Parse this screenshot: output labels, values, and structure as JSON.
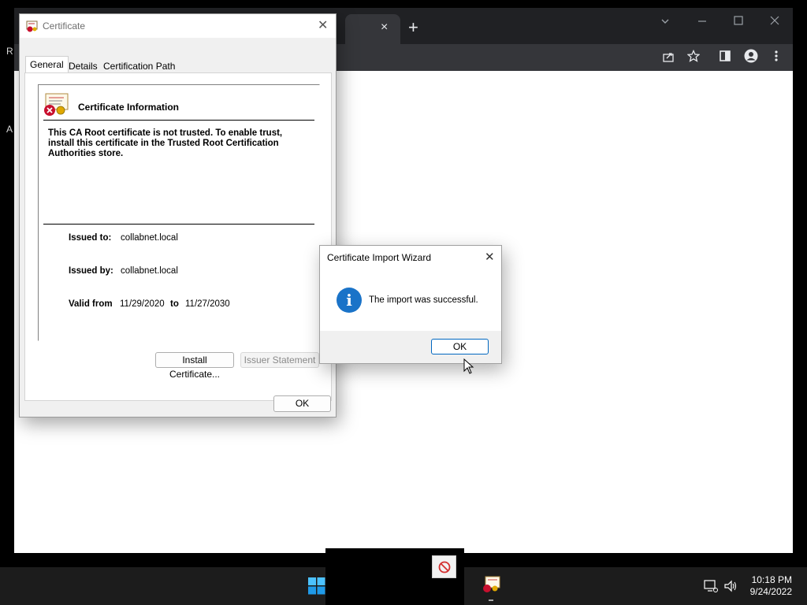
{
  "browser": {
    "left_fragments": [
      "R",
      "A"
    ],
    "tab_close": "×",
    "new_tab": "+"
  },
  "cert_dialog": {
    "title": "Certificate",
    "close": "✕",
    "tabs": [
      "General",
      "Details",
      "Certification Path"
    ],
    "active_tab": "General",
    "info_title": "Certificate Information",
    "warning": "This CA Root certificate is not trusted. To enable trust, install this certificate in the Trusted Root Certification Authorities store.",
    "issued_to_label": "Issued to:",
    "issued_to": "collabnet.local",
    "issued_by_label": "Issued by:",
    "issued_by": "collabnet.local",
    "valid_from_label": "Valid from",
    "valid_from": "11/29/2020",
    "to_label": "to",
    "valid_to": "11/27/2030",
    "install_button": "Install Certificate...",
    "issuer_button": "Issuer Statement",
    "ok_button": "OK"
  },
  "wizard_dialog": {
    "title": "Certificate Import Wizard",
    "close": "✕",
    "message": "The import was successful.",
    "ok_button": "OK"
  },
  "taskbar": {
    "time": "10:18 PM",
    "date": "9/24/2022"
  },
  "colors": {
    "accent": "#0067c0",
    "info_icon": "#1a73c8",
    "taskbar": "#1c1c1c",
    "browser_frame": "#202124"
  }
}
